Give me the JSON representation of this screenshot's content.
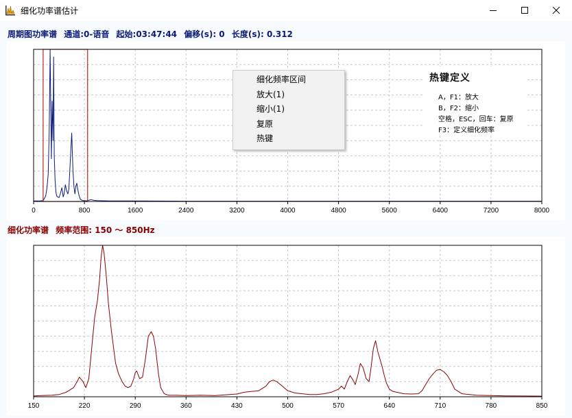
{
  "window": {
    "title": "细化功率谱估计"
  },
  "top_header": {
    "label": "周期图功率谱",
    "channel": "通道:0-语音",
    "start": "起始:03:47:44",
    "offset": "偏移(s): 0",
    "length": "长度(s): 0.312"
  },
  "bottom_header": {
    "label": "细化功率谱",
    "range": "频率范围: 150 ～  850Hz"
  },
  "context_menu": {
    "items": [
      "细化频率区间",
      "放大(1)",
      "缩小(1)",
      "复原",
      "热键"
    ]
  },
  "hotkeys": {
    "title": "热键定义",
    "lines": [
      "A，F1：放大",
      "B，F2：缩小",
      "空格，ESC，回车：复原",
      "F3：定义细化频率"
    ]
  },
  "colors": {
    "top_header": "#0a1a78",
    "bottom_header": "#8b0000",
    "top_trace": "#0a1a78",
    "bottom_trace": "#8b0000",
    "selection": "#c42020",
    "grid": "#c8c8c8"
  },
  "chart_data": [
    {
      "type": "line",
      "xlim": [
        0,
        8000
      ],
      "ticks": [
        0,
        800,
        1600,
        2400,
        3200,
        4000,
        4800,
        5600,
        6400,
        7200,
        8000
      ],
      "grid": true,
      "selection_range": [
        150,
        850
      ],
      "x": [
        0,
        100,
        150,
        190,
        210,
        230,
        245,
        260,
        272,
        280,
        292,
        305,
        315,
        325,
        338,
        352,
        365,
        380,
        400,
        420,
        445,
        465,
        480,
        500,
        520,
        540,
        555,
        575,
        600,
        620,
        635,
        650,
        665,
        680,
        700,
        715,
        735,
        760,
        785,
        805,
        825,
        850,
        900,
        950,
        1000,
        1200,
        1600,
        2400,
        3200,
        4000,
        4800,
        5600,
        6400,
        7200,
        8000
      ],
      "y": [
        0.003,
        0.003,
        0.006,
        0.035,
        0.09,
        0.18,
        0.45,
        1.0,
        0.55,
        0.28,
        0.66,
        0.4,
        0.95,
        0.3,
        0.14,
        0.06,
        0.035,
        0.03,
        0.025,
        0.05,
        0.09,
        0.03,
        0.05,
        0.11,
        0.07,
        0.05,
        0.08,
        0.25,
        0.45,
        0.2,
        0.1,
        0.05,
        0.1,
        0.12,
        0.07,
        0.04,
        0.015,
        0.008,
        0.005,
        0.006,
        0.004,
        0.005,
        0.012,
        0.007,
        0.006,
        0.003,
        0.003,
        0.002,
        0.002,
        0.002,
        0.002,
        0.002,
        0.002,
        0.002,
        0.002
      ]
    },
    {
      "type": "line",
      "xlim": [
        150,
        850
      ],
      "ticks": [
        150,
        220,
        290,
        360,
        430,
        500,
        570,
        640,
        710,
        780,
        850
      ],
      "grid": true,
      "x": [
        150,
        160,
        175,
        185,
        195,
        205,
        210,
        213,
        218,
        222,
        226,
        230,
        234,
        238,
        241,
        243,
        245,
        247,
        250,
        253,
        257,
        260,
        263,
        267,
        272,
        276,
        280,
        284,
        288,
        290,
        292,
        296,
        300,
        304,
        308,
        312,
        315,
        318,
        322,
        325,
        330,
        336,
        345,
        360,
        380,
        400,
        420,
        430,
        440,
        450,
        460,
        470,
        475,
        480,
        485,
        490,
        495,
        500,
        510,
        520,
        530,
        540,
        550,
        560,
        565,
        570,
        574,
        578,
        582,
        586,
        590,
        593,
        597,
        600,
        604,
        608,
        612,
        615,
        618,
        621,
        624,
        627,
        630,
        633,
        636,
        640,
        645,
        650,
        660,
        670,
        680,
        685,
        690,
        695,
        700,
        705,
        710,
        715,
        720,
        725,
        730,
        740,
        760,
        780,
        800,
        825,
        850
      ],
      "y": [
        0.005,
        0.008,
        0.01,
        0.015,
        0.03,
        0.06,
        0.1,
        0.13,
        0.1,
        0.06,
        0.12,
        0.32,
        0.52,
        0.64,
        0.78,
        0.92,
        1.0,
        0.95,
        0.8,
        0.62,
        0.44,
        0.33,
        0.22,
        0.15,
        0.1,
        0.07,
        0.06,
        0.07,
        0.12,
        0.16,
        0.17,
        0.12,
        0.13,
        0.25,
        0.4,
        0.43,
        0.4,
        0.32,
        0.15,
        0.06,
        0.02,
        0.01,
        0.01,
        0.008,
        0.01,
        0.008,
        0.015,
        0.018,
        0.03,
        0.035,
        0.04,
        0.07,
        0.1,
        0.11,
        0.1,
        0.08,
        0.06,
        0.04,
        0.025,
        0.02,
        0.015,
        0.015,
        0.02,
        0.03,
        0.04,
        0.05,
        0.07,
        0.05,
        0.1,
        0.14,
        0.11,
        0.08,
        0.15,
        0.22,
        0.19,
        0.12,
        0.1,
        0.2,
        0.32,
        0.37,
        0.3,
        0.25,
        0.2,
        0.14,
        0.09,
        0.05,
        0.035,
        0.03,
        0.02,
        0.018,
        0.02,
        0.04,
        0.08,
        0.12,
        0.15,
        0.175,
        0.18,
        0.165,
        0.14,
        0.1,
        0.05,
        0.02,
        0.01,
        0.008,
        0.006,
        0.005,
        0.004
      ]
    }
  ]
}
